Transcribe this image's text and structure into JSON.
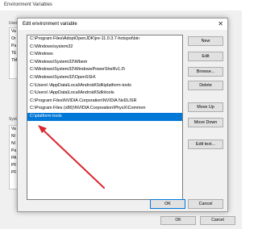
{
  "background_window": {
    "title": "Environment Variables",
    "user_section_label": "User",
    "system_section_label": "Syste",
    "user_rows": [
      "Va",
      "Or",
      "Pa",
      "TE",
      "TM"
    ],
    "system_rows": [
      "Va",
      "Nl",
      "Nl",
      "Pa",
      "PA",
      "PF",
      "PF"
    ],
    "buttons": {
      "ok": "OK",
      "cancel": "Cancel"
    }
  },
  "dialog": {
    "title": "Edit environment variable",
    "close_glyph": "✕",
    "paths": [
      "C:\\Program Files\\AdoptOpenJDK\\jre-11.0.3.7-hotspot\\bin",
      "C:\\Windows\\system32",
      "C:\\Windows",
      "C:\\Windows\\System32\\Wbem",
      "C:\\Windows\\System32\\WindowsPowerShell\\v1.0\\",
      "C:\\Windows\\System32\\OpenSSH\\",
      "C:\\Users\\          \\AppData\\Local\\Android\\Sdk\\platform-tools",
      "C:\\Users\\          \\AppData\\Local\\Android\\Sdk\\tools",
      "C:\\Program Files\\NVIDIA Corporation\\NVIDIA NvDLISR",
      "C:\\Program Files (x86)\\NVIDIA Corporation\\PhysX\\Common",
      "C:\\platform-tools"
    ],
    "selected_index": 10,
    "buttons": {
      "new": "New",
      "edit": "Edit",
      "browse": "Browse...",
      "delete": "Delete",
      "move_up": "Move Up",
      "move_down": "Move Down",
      "edit_text": "Edit text...",
      "ok": "OK",
      "cancel": "Cancel"
    }
  },
  "colors": {
    "selection": "#0078d7",
    "arrow": "#d9272e"
  }
}
